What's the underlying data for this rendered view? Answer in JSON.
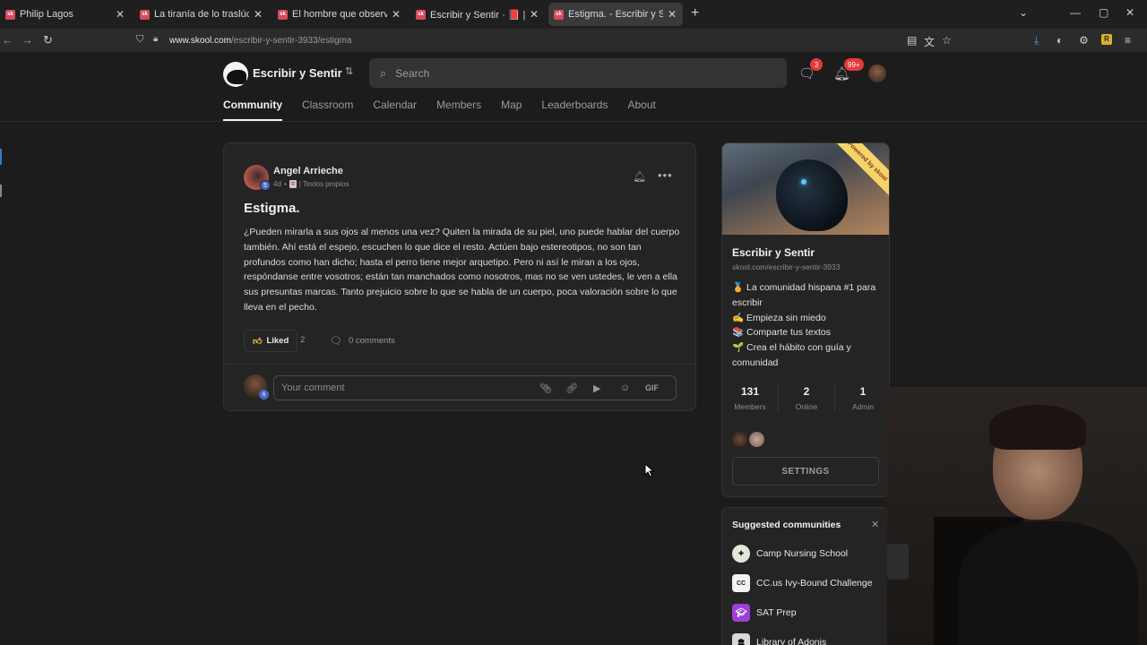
{
  "browser": {
    "tabs": [
      {
        "title": "Philip Lagos",
        "favicon": "sk",
        "active": false
      },
      {
        "title": "La tiranía de lo traslúcido - Escri",
        "favicon": "sk",
        "active": false
      },
      {
        "title": "El hombre que observó la luz II",
        "favicon": "sk",
        "active": false
      },
      {
        "title": "Escribir y Sentir · 📕 | Textos pr",
        "favicon": "sk",
        "active": false
      },
      {
        "title": "Estigma. - Escribir y Sentir",
        "favicon": "sk",
        "active": true
      }
    ],
    "url_host": "www.skool.com",
    "url_path": "/escribir-y-sentir-3933/estigma"
  },
  "header": {
    "community_name": "Escribir y Sentir",
    "search_placeholder": "Search",
    "chat_badge": "3",
    "notifications_badge": "99+",
    "nav": [
      {
        "label": "Community",
        "active": true
      },
      {
        "label": "Classroom",
        "active": false
      },
      {
        "label": "Calendar",
        "active": false
      },
      {
        "label": "Members",
        "active": false
      },
      {
        "label": "Map",
        "active": false
      },
      {
        "label": "Leaderboards",
        "active": false
      },
      {
        "label": "About",
        "active": false
      }
    ]
  },
  "post": {
    "author": "Angel Arrieche",
    "author_level": "5",
    "age": "4d",
    "meta_sep": "•",
    "category": "| Textos propios",
    "title": "Estigma.",
    "body": "¿Pueden mirarla a sus ojos al menos una vez? Quiten la mirada de su piel, uno puede hablar del cuerpo también. Ahí está el espejo, escuchen lo que dice el resto. Actúen bajo estereotipos, no son tan profundos como han dicho; hasta el perro tiene mejor arquetipo. Pero ni así le miran a los ojos, respóndanse entre vosotros; están tan manchados como nosotros, mas no se ven ustedes, le ven a ella sus presuntas marcas. Tanto prejuicio sobre lo que se habla de un cuerpo, poca valoración sobre lo que lleva en el pecho.",
    "like_label": "Liked",
    "like_count": "2",
    "comments_label": "0 comments",
    "comment_placeholder": "Your comment",
    "commenter_level": "6",
    "gif_label": "GIF"
  },
  "sidebar": {
    "ribbon": "Powered by skool",
    "name": "Escribir y Sentir",
    "url": "skool.com/escribir-y-sentir-3933",
    "description": [
      "🏅 La comunidad hispana #1 para escribir",
      "✍️ Empieza sin miedo",
      "📚 Comparte tus textos",
      "🌱 Crea el hábito con guía y comunidad"
    ],
    "stats": [
      {
        "value": "131",
        "label": "Members"
      },
      {
        "value": "2",
        "label": "Online"
      },
      {
        "value": "1",
        "label": "Admin"
      }
    ],
    "settings_label": "SETTINGS"
  },
  "suggested": {
    "title": "Suggested communities",
    "items": [
      {
        "name": "Camp Nursing School",
        "icon": "nurse-icon",
        "color": "#dfe8d8"
      },
      {
        "name": "CC.us Ivy-Bound Challenge",
        "icon": "ccus-icon",
        "color": "#f2f2f2"
      },
      {
        "name": "SAT Prep",
        "icon": "graduation-cap-icon",
        "color": "#9b3fd6"
      },
      {
        "name": "Library of Adonis",
        "icon": "columns-icon",
        "color": "#d8d8d8"
      }
    ]
  },
  "colors": {
    "accent_badge": "#e5393b",
    "level_badge": "#4a68c6",
    "like_thumb": "#f0c24b"
  }
}
